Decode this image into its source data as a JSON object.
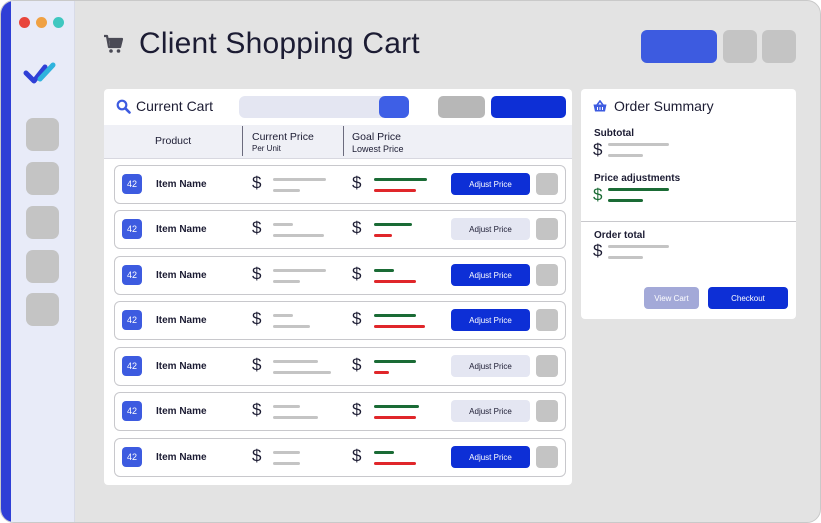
{
  "header": {
    "title": "Client Shopping Cart"
  },
  "cart": {
    "title": "Current Cart",
    "columns": {
      "product": "Product",
      "current_price": "Current Price",
      "current_price_sub": "Per Unit",
      "goal_price": "Goal Price",
      "goal_price_sub": "Lowest Price"
    },
    "currency_symbol": "$",
    "adjust_label": "Adjust Price",
    "items": [
      {
        "badge": "42",
        "name": "Item Name",
        "adjust_active": true
      },
      {
        "badge": "42",
        "name": "Item Name",
        "adjust_active": false
      },
      {
        "badge": "42",
        "name": "Item Name",
        "adjust_active": true
      },
      {
        "badge": "42",
        "name": "Item Name",
        "adjust_active": true
      },
      {
        "badge": "42",
        "name": "Item Name",
        "adjust_active": false
      },
      {
        "badge": "42",
        "name": "Item Name",
        "adjust_active": false
      },
      {
        "badge": "42",
        "name": "Item Name",
        "adjust_active": true
      }
    ]
  },
  "summary": {
    "title": "Order Summary",
    "subtotal_label": "Subtotal",
    "price_adjustments_label": "Price adjustments",
    "order_total_label": "Order total",
    "currency_symbol": "$",
    "view_cart_label": "View Cart",
    "checkout_label": "Checkout"
  },
  "colors": {
    "accent": "#0d2fd6",
    "accent_light": "#3e5fe6",
    "sidebar_edge": "#2f3fd6",
    "green": "#1a6b35",
    "red": "#e0262a",
    "placeholder_gray": "#c4c4c4"
  },
  "icons": {
    "window_dots": [
      "red-dot",
      "orange-dot",
      "teal-dot"
    ],
    "logo": "double-check-logo",
    "header": "shopping-cart-icon",
    "cart": "search-icon",
    "summary": "basket-icon"
  }
}
